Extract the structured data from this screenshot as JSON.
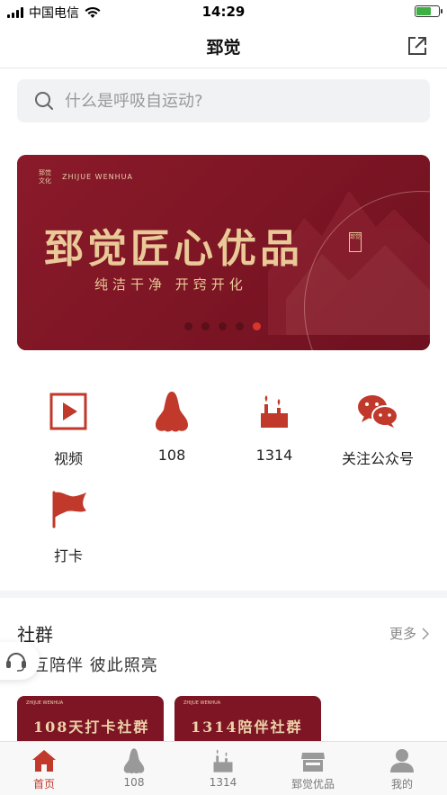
{
  "status_bar": {
    "carrier": "中国电信",
    "time": "14:29"
  },
  "nav": {
    "title": "郅觉"
  },
  "search": {
    "placeholder": "什么是呼吸自运动?"
  },
  "banner": {
    "brand_cn": "郅觉文化",
    "brand_en": "ZHIJUE WENHUA",
    "title": "郅觉匠心优品",
    "subtitle": "纯洁干净 开窍开化",
    "seal": "郅觉",
    "slide_count": 5,
    "active_slide": 5
  },
  "quick_menu": [
    {
      "label": "视频",
      "icon": "play-video-icon"
    },
    {
      "label": "108",
      "icon": "nose-icon"
    },
    {
      "label": "1314",
      "icon": "candles-icon"
    },
    {
      "label": "关注公众号",
      "icon": "wechat-icon"
    },
    {
      "label": "打卡",
      "icon": "flag-icon"
    }
  ],
  "community": {
    "title": "社群",
    "more": "更多",
    "subtitle": "互陪伴 彼此照亮",
    "cards": [
      {
        "title": "108天打卡社群",
        "brand": "ZHIJUE WENHUA"
      },
      {
        "title": "1314陪伴社群",
        "brand": "ZHIJUE WENHUA"
      }
    ]
  },
  "tabbar": {
    "items": [
      {
        "label": "首页",
        "icon": "home-icon",
        "active": true
      },
      {
        "label": "108",
        "icon": "nose-icon",
        "active": false
      },
      {
        "label": "1314",
        "icon": "candles-icon",
        "active": false
      },
      {
        "label": "郅觉优品",
        "icon": "shop-icon",
        "active": false
      },
      {
        "label": "我的",
        "icon": "profile-icon",
        "active": false
      }
    ]
  },
  "colors": {
    "brand_red": "#c0392b",
    "banner_red": "#7d1525",
    "gold": "#e9c997"
  }
}
